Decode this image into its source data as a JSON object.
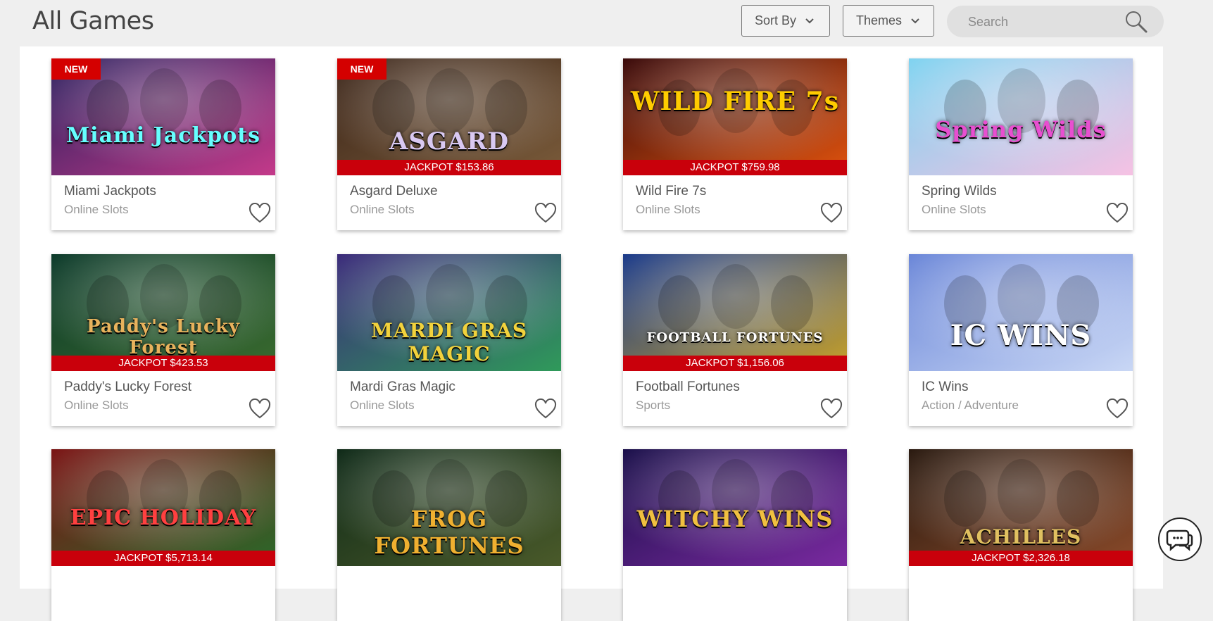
{
  "header": {
    "title": "All Games",
    "sort_label": "Sort By",
    "themes_label": "Themes",
    "search_placeholder": "Search"
  },
  "games": [
    {
      "title": "Miami Jackpots",
      "category": "Online Slots",
      "badge": "NEW",
      "jackpot": "",
      "logo": "Miami Jackpots"
    },
    {
      "title": "Asgard Deluxe",
      "category": "Online Slots",
      "badge": "NEW",
      "jackpot": "JACKPOT $153.86",
      "logo": "ASGARD"
    },
    {
      "title": "Wild Fire 7s",
      "category": "Online Slots",
      "badge": "",
      "jackpot": "JACKPOT $759.98",
      "logo": "WILD FIRE 7s"
    },
    {
      "title": "Spring Wilds",
      "category": "Online Slots",
      "badge": "",
      "jackpot": "",
      "logo": "Spring Wilds"
    },
    {
      "title": "Paddy's Lucky Forest",
      "category": "Online Slots",
      "badge": "",
      "jackpot": "JACKPOT $423.53",
      "logo": "Paddy's Lucky Forest"
    },
    {
      "title": "Mardi Gras Magic",
      "category": "Online Slots",
      "badge": "",
      "jackpot": "",
      "logo": "MARDI GRAS MAGIC"
    },
    {
      "title": "Football Fortunes",
      "category": "Sports",
      "badge": "",
      "jackpot": "JACKPOT $1,156.06",
      "logo": "FOOTBALL FORTUNES"
    },
    {
      "title": "IC Wins",
      "category": "Action / Adventure",
      "badge": "",
      "jackpot": "",
      "logo": "IC WINS"
    },
    {
      "title": "",
      "category": "",
      "badge": "",
      "jackpot": "JACKPOT $5,713.14",
      "logo": "EPIC HOLIDAY"
    },
    {
      "title": "",
      "category": "",
      "badge": "",
      "jackpot": "",
      "logo": "FROG FORTUNES"
    },
    {
      "title": "",
      "category": "",
      "badge": "",
      "jackpot": "",
      "logo": "WITCHY WINS"
    },
    {
      "title": "",
      "category": "",
      "badge": "",
      "jackpot": "JACKPOT $2,326.18",
      "logo": "ACHILLES"
    }
  ],
  "colors": {
    "jackpot_bar": "#c9000b",
    "new_badge": "#d40000",
    "background": "#efefef"
  },
  "icons": {
    "search": "search-icon",
    "heart": "heart-icon",
    "chevron": "chevron-down-icon",
    "chat": "chat-icon"
  }
}
